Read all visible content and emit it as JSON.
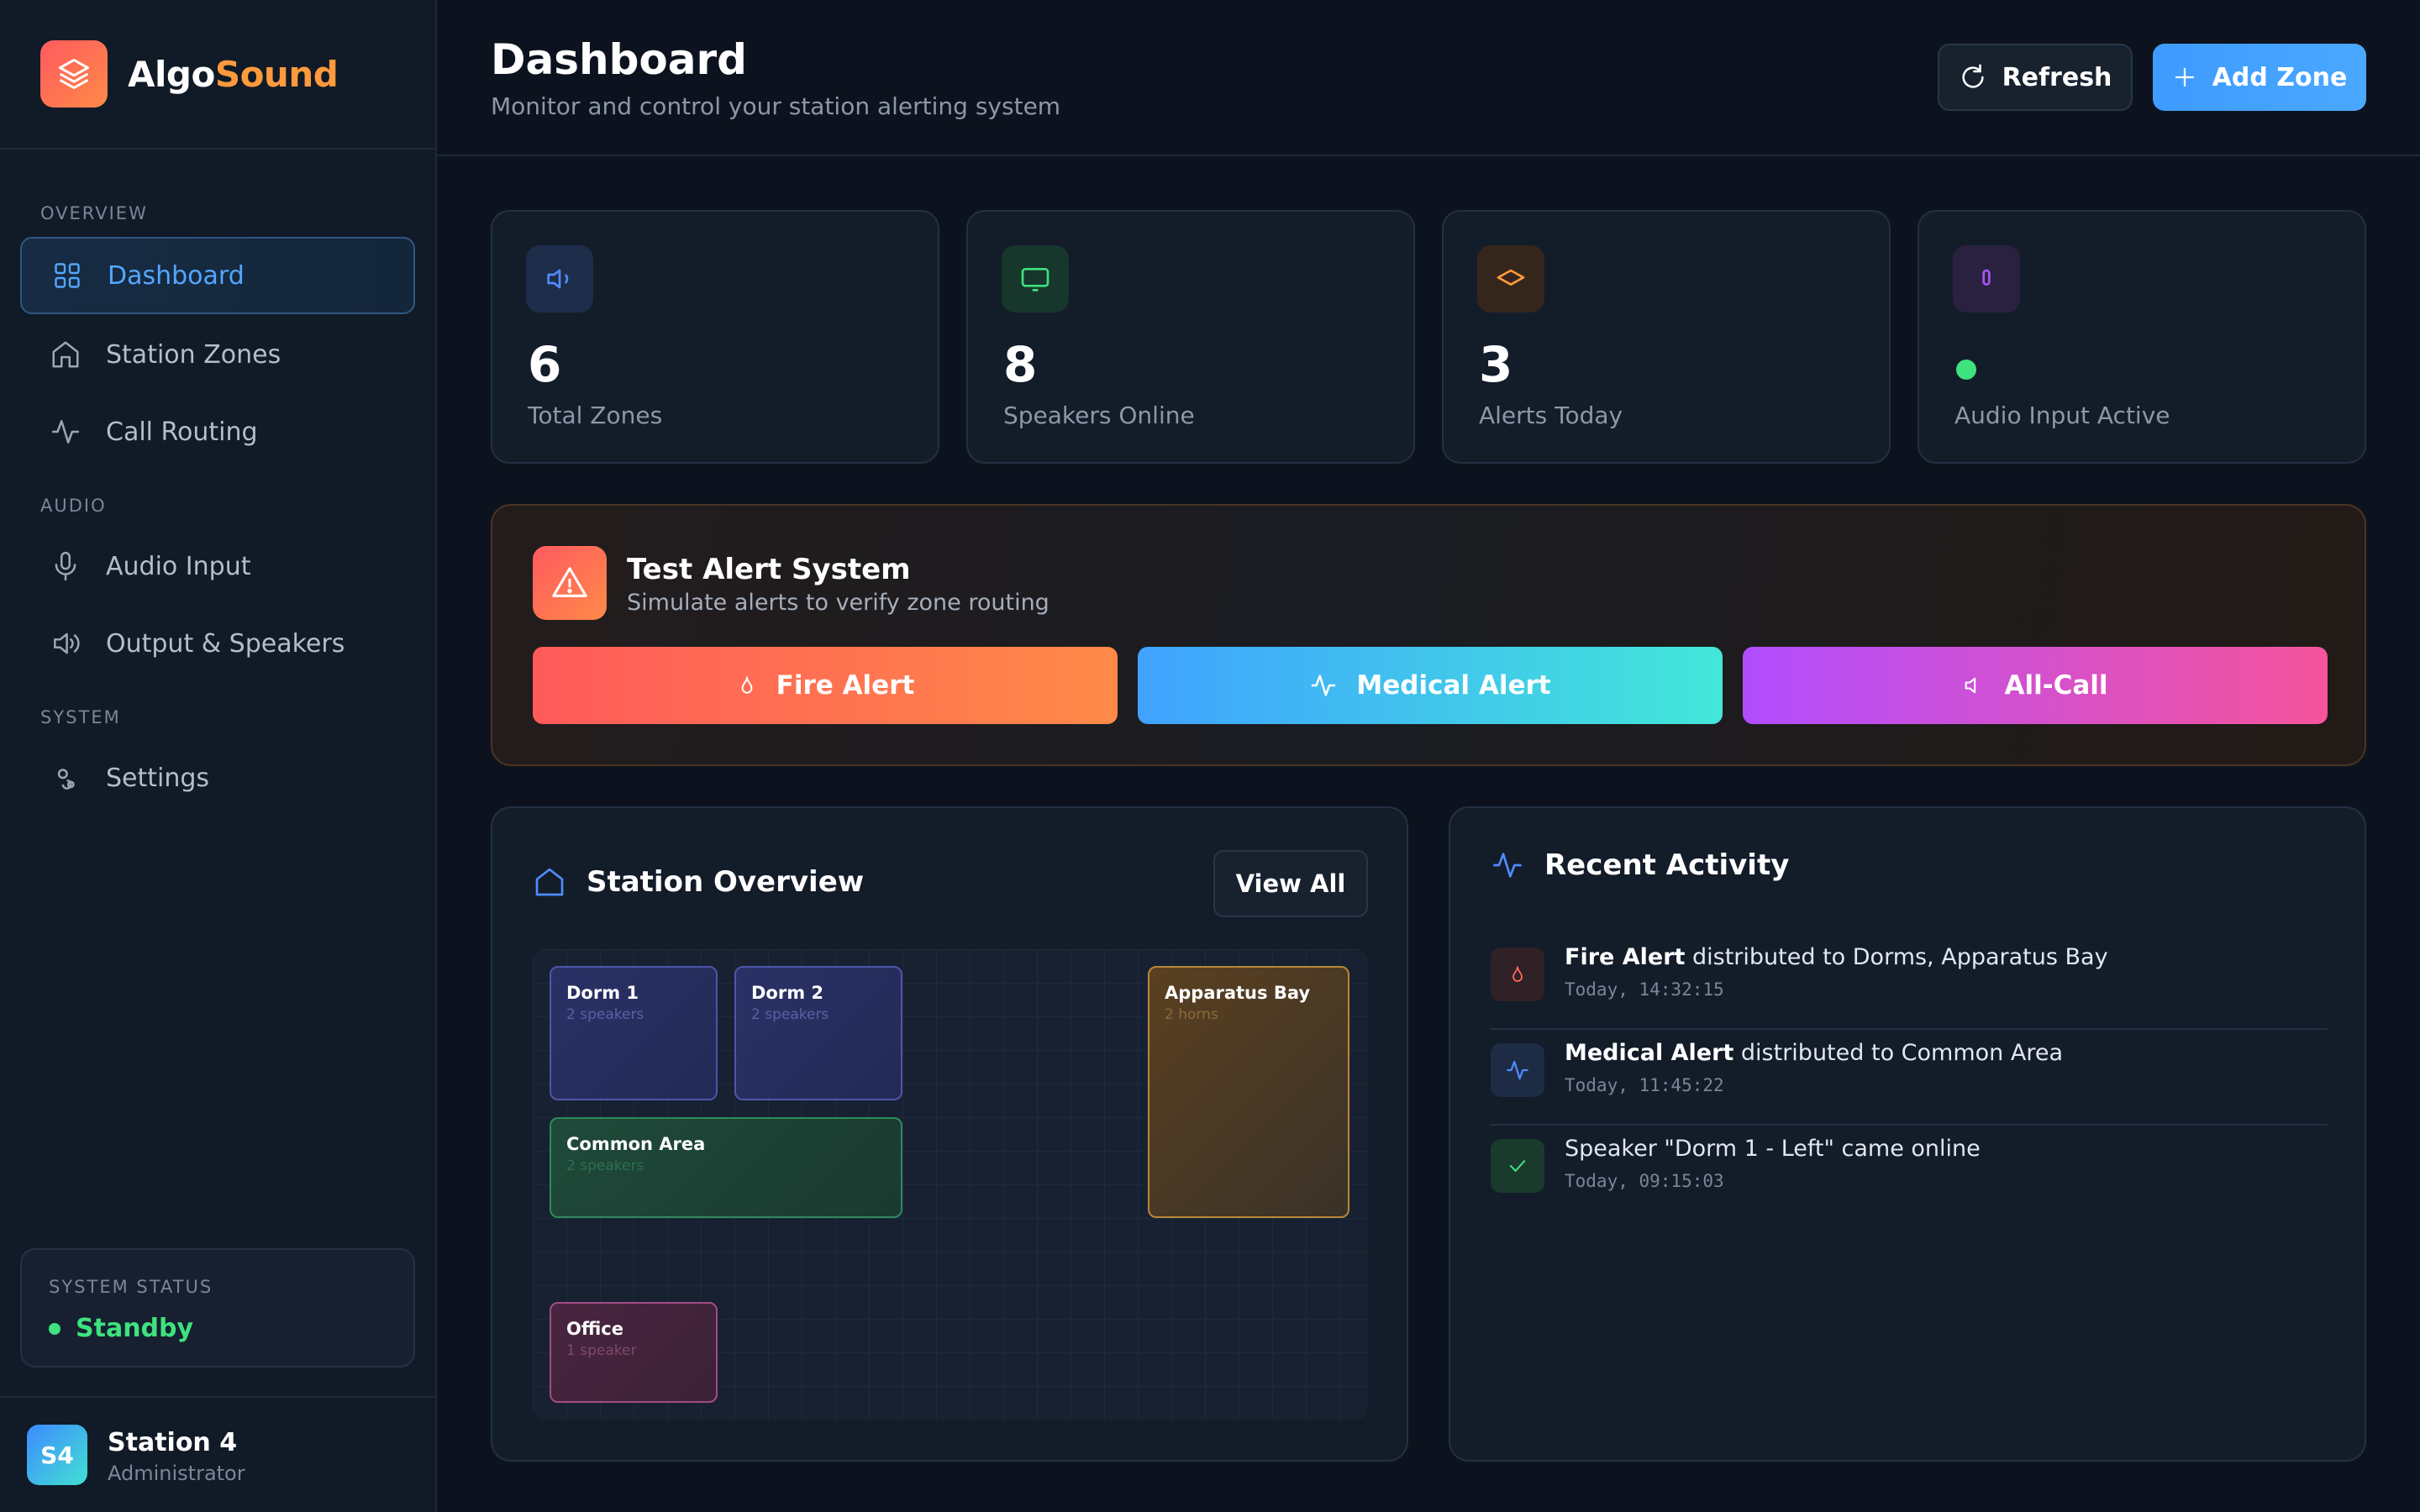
{
  "brand": {
    "name_part1": "Algo",
    "name_part2": "Sound"
  },
  "sidebar": {
    "sections": [
      "OVERVIEW",
      "AUDIO",
      "SYSTEM"
    ],
    "items": [
      {
        "label": "Dashboard",
        "icon": "grid-icon",
        "active": true
      },
      {
        "label": "Station Zones",
        "icon": "home-icon"
      },
      {
        "label": "Call Routing",
        "icon": "activity-icon"
      },
      {
        "label": "Audio Input",
        "icon": "microphone-icon"
      },
      {
        "label": "Output & Speakers",
        "icon": "speaker-icon"
      },
      {
        "label": "Settings",
        "icon": "gear-icon"
      }
    ],
    "status": {
      "label": "SYSTEM STATUS",
      "value": "Standby",
      "color": "#3ee27e"
    },
    "user": {
      "initials": "S4",
      "name": "Station 4",
      "role": "Administrator"
    }
  },
  "header": {
    "title": "Dashboard",
    "subtitle": "Monitor and control your station alerting system",
    "refresh_label": "Refresh",
    "add_zone_label": "Add Zone"
  },
  "stats": [
    {
      "value": "6",
      "label": "Total Zones",
      "icon": "speaker-icon",
      "color": "#4f8cff"
    },
    {
      "value": "8",
      "label": "Speakers Online",
      "icon": "monitor-icon",
      "color": "#3ee27e"
    },
    {
      "value": "3",
      "label": "Alerts Today",
      "icon": "layers-icon",
      "color": "#ff9a3c"
    },
    {
      "value": "",
      "label": "Audio Input Active",
      "icon": "microphone-icon",
      "color": "#a855f7"
    }
  ],
  "test_alert": {
    "title": "Test Alert System",
    "subtitle": "Simulate alerts to verify zone routing",
    "buttons": [
      {
        "label": "Fire Alert",
        "icon": "flame-icon"
      },
      {
        "label": "Medical Alert",
        "icon": "pulse-icon"
      },
      {
        "label": "All-Call",
        "icon": "speaker-icon"
      }
    ]
  },
  "station_overview": {
    "title": "Station Overview",
    "view_all_label": "View All",
    "zones": [
      {
        "name": "Dorm 1",
        "detail": "2 speakers"
      },
      {
        "name": "Dorm 2",
        "detail": "2 speakers"
      },
      {
        "name": "Common Area",
        "detail": "2 speakers"
      },
      {
        "name": "Apparatus Bay",
        "detail": "2 horns"
      },
      {
        "name": "Office",
        "detail": "1 speaker"
      }
    ]
  },
  "recent_activity": {
    "title": "Recent Activity",
    "items": [
      {
        "bold": "Fire Alert",
        "text": " distributed to Dorms, Apparatus Bay",
        "time": "Today, 14:32:15",
        "icon": "flame-icon"
      },
      {
        "bold": "Medical Alert",
        "text": " distributed to Common Area",
        "time": "Today, 11:45:22",
        "icon": "pulse-icon"
      },
      {
        "bold": "",
        "text": "Speaker \"Dorm 1 - Left\" came online",
        "time": "Today, 09:15:03",
        "icon": "check-icon"
      }
    ]
  }
}
